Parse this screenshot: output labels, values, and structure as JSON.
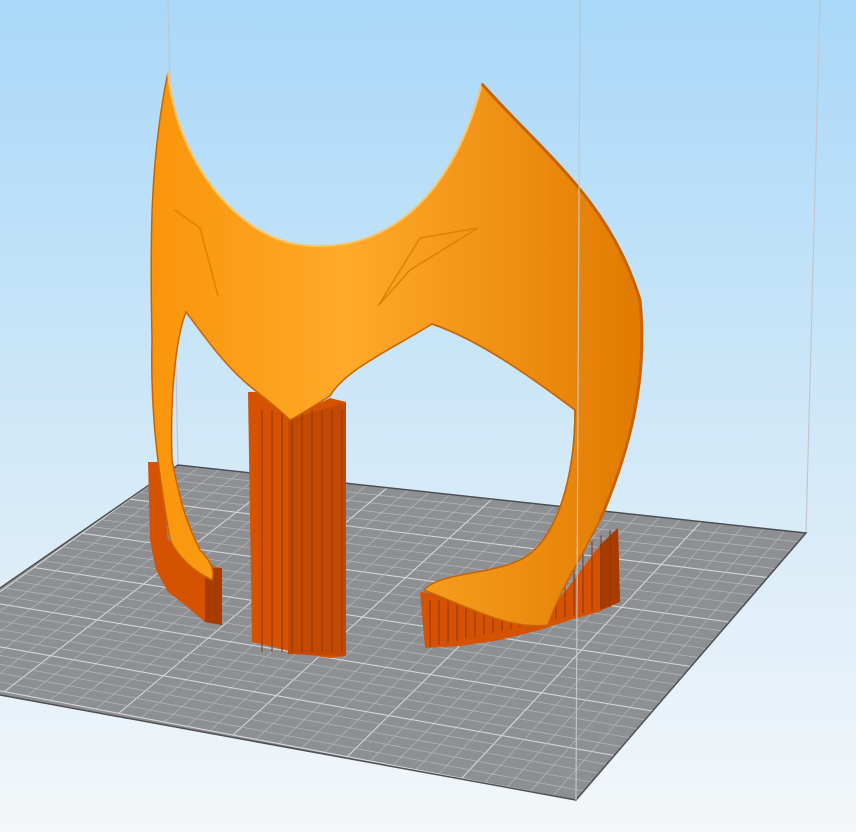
{
  "viewport": {
    "background_top": "#a9d8f8",
    "background_bottom": "#f4f7f9"
  },
  "build_plate": {
    "fill": "#8d8f93",
    "grid_line": "#b6b8bb",
    "major_grid_line": "#d4d6d8",
    "edge": "#4d4f52"
  },
  "build_volume": {
    "line_color": "#c2c6ca"
  },
  "model": {
    "name": "",
    "color_light": "#ffa92a",
    "color_mid": "#f9950a",
    "color_dark": "#e17a00",
    "edge_color": "#c86400"
  },
  "supports": {
    "color": "#d55300",
    "color_dark": "#a83c00",
    "color_light": "#e86a10"
  }
}
